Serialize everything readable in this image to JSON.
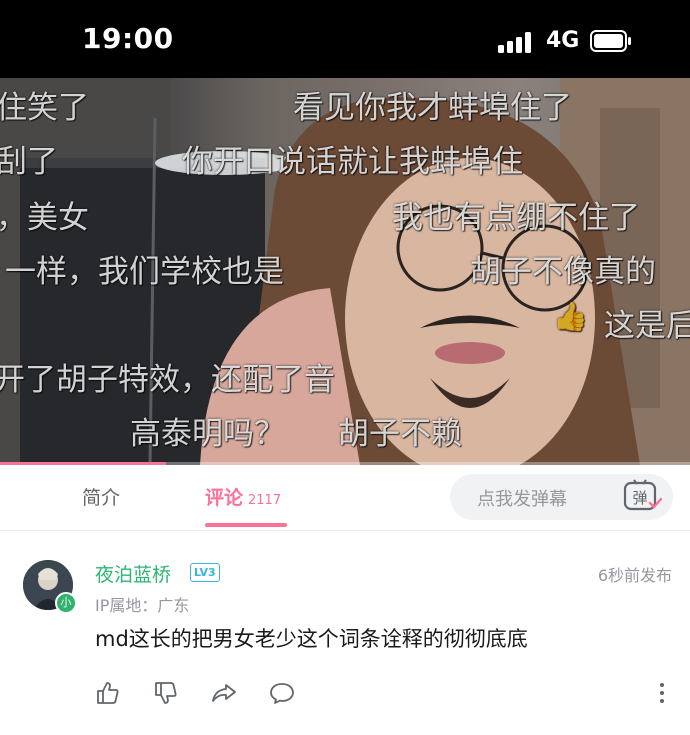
{
  "status_bar": {
    "time": "19:00",
    "network": "4G"
  },
  "video": {
    "progress": 0.24,
    "danmaku": [
      {
        "text": "住笑了"
      },
      {
        "text": "看见你我才蚌埠住了"
      },
      {
        "text": "刮了"
      },
      {
        "text": "你开口说话就让我蚌埠住"
      },
      {
        "text": "，美女"
      },
      {
        "text": "我也有点绷不住了"
      },
      {
        "text": "一样，我们学校也是"
      },
      {
        "text": "胡子不像真的"
      },
      {
        "text": "这是后"
      },
      {
        "text": "开了胡子特效，还配了音"
      },
      {
        "text": "高泰明吗？"
      },
      {
        "text": "胡子不赖"
      }
    ]
  },
  "tabs": {
    "intro_label": "简介",
    "comments_label": "评论",
    "comments_count": "2117",
    "danmaku_placeholder": "点我发弹幕",
    "danmaku_button": "弹"
  },
  "comment": {
    "username": "夜泊蓝桥",
    "level": "LV3",
    "timestamp": "6秒前发布",
    "ip_location": "IP属地：广东",
    "text": "md这长的把男女老少这个词条诠释的彻彻底底",
    "avatar_badge": "小"
  },
  "icons": [
    "signal-icon",
    "battery-icon",
    "danmaku-icon",
    "like-icon",
    "dislike-icon",
    "share-icon",
    "reply-icon",
    "more-icon"
  ]
}
